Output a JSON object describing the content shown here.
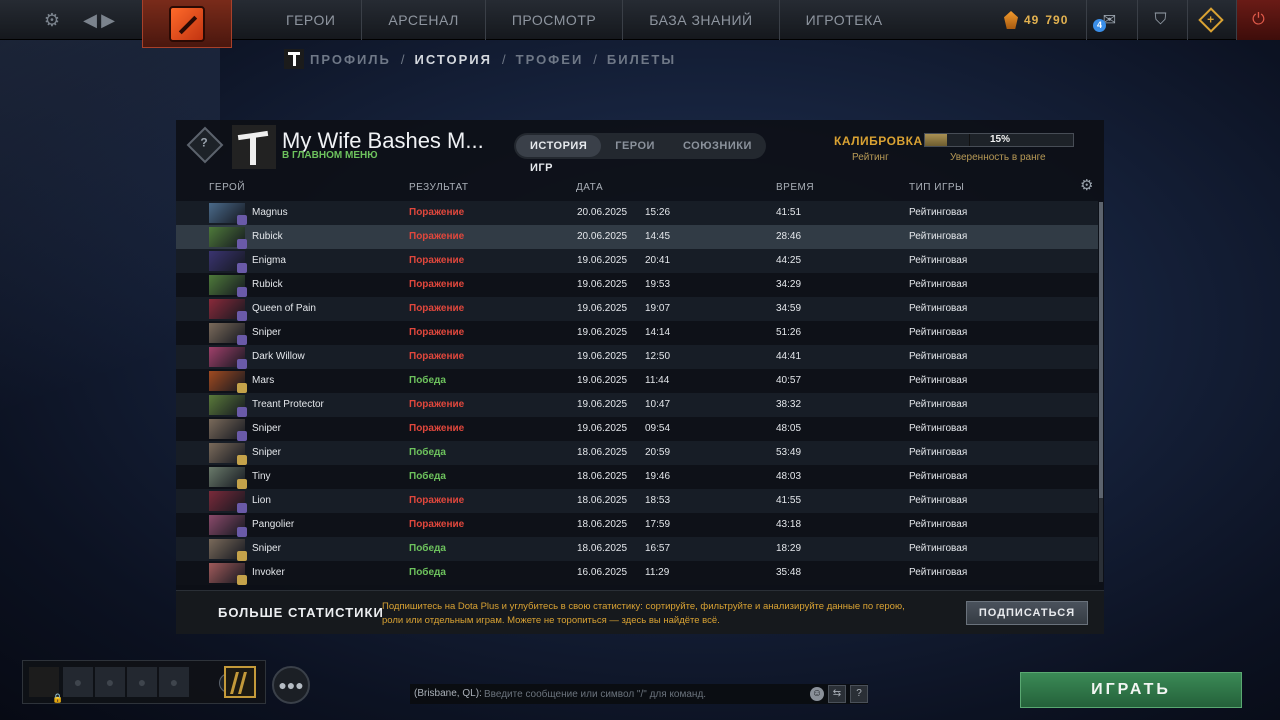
{
  "nav": {
    "items": [
      "ГЕРОИ",
      "АРСЕНАЛ",
      "ПРОСМОТР",
      "БАЗА ЗНАНИЙ",
      "ИГРОТЕКА"
    ]
  },
  "currency": {
    "value1": "49",
    "value2": "790"
  },
  "notifications": {
    "count": "4"
  },
  "subnav": {
    "items": [
      "ПРОФИЛЬ",
      "ИСТОРИЯ",
      "ТРОФЕИ",
      "БИЛЕТЫ"
    ],
    "separator": "/",
    "active_index": 1
  },
  "profile": {
    "name": "My Wife Bashes M...",
    "status": "В ГЛАВНОМ МЕНЮ",
    "rank_symbol": "?"
  },
  "tabs": [
    "ИСТОРИЯ ИГР",
    "ГЕРОИ",
    "СОЮЗНИКИ"
  ],
  "calibration": {
    "title": "КАЛИБРОВКА",
    "rating_label": "Рейтинг",
    "confidence_value": "15%",
    "confidence_fraction": 0.15,
    "confidence_label": "Уверенность в ранге"
  },
  "table": {
    "headers": [
      "ГЕРОЙ",
      "РЕЗУЛЬТАТ",
      "ДАТА",
      "ВРЕМЯ",
      "ТИП ИГРЫ"
    ],
    "rows": [
      {
        "hero": "Magnus",
        "result": "Поражение",
        "win": false,
        "date": "20.06.2025",
        "time": "15:26",
        "duration": "41:51",
        "type": "Рейтинговая",
        "color": "#4a6a8a"
      },
      {
        "hero": "Rubick",
        "result": "Поражение",
        "win": false,
        "date": "20.06.2025",
        "time": "14:45",
        "duration": "28:46",
        "type": "Рейтинговая",
        "color": "#4e7a3a"
      },
      {
        "hero": "Enigma",
        "result": "Поражение",
        "win": false,
        "date": "19.06.2025",
        "time": "20:41",
        "duration": "44:25",
        "type": "Рейтинговая",
        "color": "#3a3470"
      },
      {
        "hero": "Rubick",
        "result": "Поражение",
        "win": false,
        "date": "19.06.2025",
        "time": "19:53",
        "duration": "34:29",
        "type": "Рейтинговая",
        "color": "#4e7a3a"
      },
      {
        "hero": "Queen of Pain",
        "result": "Поражение",
        "win": false,
        "date": "19.06.2025",
        "time": "19:07",
        "duration": "34:59",
        "type": "Рейтинговая",
        "color": "#8a2a3a"
      },
      {
        "hero": "Sniper",
        "result": "Поражение",
        "win": false,
        "date": "19.06.2025",
        "time": "14:14",
        "duration": "51:26",
        "type": "Рейтинговая",
        "color": "#7a6a5a"
      },
      {
        "hero": "Dark Willow",
        "result": "Поражение",
        "win": false,
        "date": "19.06.2025",
        "time": "12:50",
        "duration": "44:41",
        "type": "Рейтинговая",
        "color": "#a0406a"
      },
      {
        "hero": "Mars",
        "result": "Победа",
        "win": true,
        "date": "19.06.2025",
        "time": "11:44",
        "duration": "40:57",
        "type": "Рейтинговая",
        "color": "#a04a20"
      },
      {
        "hero": "Treant Protector",
        "result": "Поражение",
        "win": false,
        "date": "19.06.2025",
        "time": "10:47",
        "duration": "38:32",
        "type": "Рейтинговая",
        "color": "#5a7a3a"
      },
      {
        "hero": "Sniper",
        "result": "Поражение",
        "win": false,
        "date": "19.06.2025",
        "time": "09:54",
        "duration": "48:05",
        "type": "Рейтинговая",
        "color": "#7a6a5a"
      },
      {
        "hero": "Sniper",
        "result": "Победа",
        "win": true,
        "date": "18.06.2025",
        "time": "20:59",
        "duration": "53:49",
        "type": "Рейтинговая",
        "color": "#7a6a5a"
      },
      {
        "hero": "Tiny",
        "result": "Победа",
        "win": true,
        "date": "18.06.2025",
        "time": "19:46",
        "duration": "48:03",
        "type": "Рейтинговая",
        "color": "#6a7a6a"
      },
      {
        "hero": "Lion",
        "result": "Поражение",
        "win": false,
        "date": "18.06.2025",
        "time": "18:53",
        "duration": "41:55",
        "type": "Рейтинговая",
        "color": "#7a2a3a"
      },
      {
        "hero": "Pangolier",
        "result": "Поражение",
        "win": false,
        "date": "18.06.2025",
        "time": "17:59",
        "duration": "43:18",
        "type": "Рейтинговая",
        "color": "#8a4a6a"
      },
      {
        "hero": "Sniper",
        "result": "Победа",
        "win": true,
        "date": "18.06.2025",
        "time": "16:57",
        "duration": "18:29",
        "type": "Рейтинговая",
        "color": "#7a6a5a"
      },
      {
        "hero": "Invoker",
        "result": "Победа",
        "win": true,
        "date": "16.06.2025",
        "time": "11:29",
        "duration": "35:48",
        "type": "Рейтинговая",
        "color": "#a05a5a"
      }
    ]
  },
  "promo": {
    "title": "БОЛЬШЕ СТАТИСТИКИ",
    "text": "Подпишитесь на Dota Plus и углубитесь в свою статистику: сортируйте, фильтруйте и анализируйте данные по герою, роли или отдельным играм. Можете не торопиться — здесь вы найдёте всё.",
    "button": "ПОДПИСАТЬСЯ"
  },
  "chat": {
    "channel": "(Brisbane, QL):",
    "placeholder": "Введите сообщение или символ \"/\" для команд."
  },
  "play": {
    "label": "ИГРАТЬ"
  }
}
